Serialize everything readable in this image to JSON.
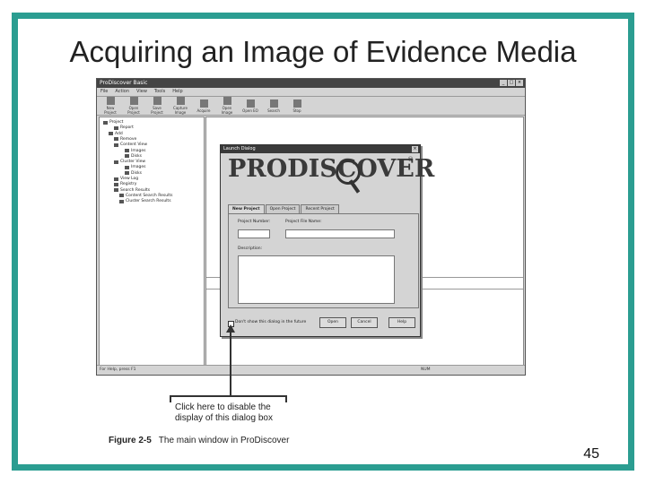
{
  "slide": {
    "title": "Acquiring an Image of Evidence Media",
    "page_number": "45",
    "accent_color": "#2b9d91"
  },
  "app": {
    "window_title": "ProDiscover Basic",
    "menu": [
      "File",
      "Action",
      "View",
      "Tools",
      "Help"
    ],
    "toolbar": [
      {
        "label": "New Project",
        "icon": "new-project-icon"
      },
      {
        "label": "Open Project",
        "icon": "open-project-icon"
      },
      {
        "label": "Save Project",
        "icon": "save-project-icon"
      },
      {
        "label": "Capture Image",
        "icon": "capture-image-icon"
      },
      {
        "label": "Acquire",
        "icon": "acquire-icon"
      },
      {
        "label": "Open Image",
        "icon": "open-image-icon"
      },
      {
        "label": "Open EO",
        "icon": "open-eo-icon"
      },
      {
        "label": "Search",
        "icon": "search-icon"
      },
      {
        "label": "Stop",
        "icon": "stop-icon"
      }
    ],
    "tree": [
      {
        "label": "Project",
        "indent": 0
      },
      {
        "label": "Report",
        "indent": 2
      },
      {
        "label": "Add",
        "indent": 1
      },
      {
        "label": "Remove",
        "indent": 2
      },
      {
        "label": "Content View",
        "indent": 2
      },
      {
        "label": "Images",
        "indent": 4
      },
      {
        "label": "Disks",
        "indent": 4
      },
      {
        "label": "Cluster View",
        "indent": 2
      },
      {
        "label": "Images",
        "indent": 4
      },
      {
        "label": "Disks",
        "indent": 4
      },
      {
        "label": "View Log",
        "indent": 2
      },
      {
        "label": "Registry",
        "indent": 2
      },
      {
        "label": "Search Results",
        "indent": 2
      },
      {
        "label": "Content Search Results",
        "indent": 3
      },
      {
        "label": "Cluster Search Results",
        "indent": 3
      }
    ],
    "status_text": "For Help, press F1",
    "status_num": "NUM"
  },
  "dialog": {
    "title": "Launch Dialog",
    "logo": "PRODISCOVER",
    "logo_reg": "®",
    "tabs": [
      "New Project",
      "Open Project",
      "Recent Project"
    ],
    "project_number_label": "Project Number:",
    "project_file_name_label": "Project File Name:",
    "description_label": "Description:",
    "checkbox_label": "Don't show this dialog in the future",
    "open_label": "Open",
    "cancel_label": "Cancel",
    "help_label": "Help"
  },
  "callout": {
    "line1": "Click here to disable the",
    "line2": "display of this dialog box"
  },
  "caption": {
    "figure": "Figure 2-5",
    "text": "The main window in ProDiscover"
  }
}
